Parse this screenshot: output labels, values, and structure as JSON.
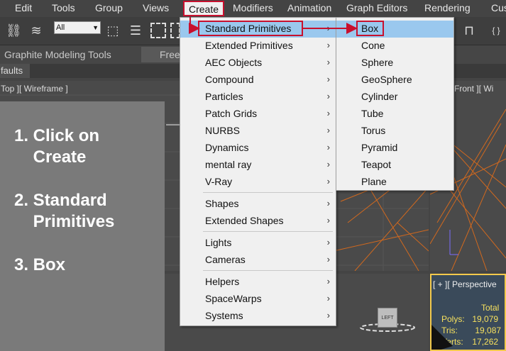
{
  "menubar": {
    "items": [
      "Edit",
      "Tools",
      "Group",
      "Views",
      "Create",
      "Modifiers",
      "Animation",
      "Graph Editors",
      "Rendering",
      "Cus"
    ]
  },
  "toolbar": {
    "selection_set": "All"
  },
  "ribbon": {
    "tab1": "Graphite Modeling Tools",
    "tab2": "Free",
    "subtab": "faults"
  },
  "viewports": {
    "top": "Top ][ Wireframe ]",
    "front": "Front ][ Wi",
    "persp": "[ + ][ Perspective",
    "gizmo_label": "LEFT",
    "stats": {
      "title": "Total",
      "polys_label": "Polys:",
      "polys": "19,079",
      "tris_label": "Tris:",
      "tris": "19,087",
      "verts_label": "Verts:",
      "verts": "17,262"
    }
  },
  "instructions": {
    "step1": "1. Click on\n    Create",
    "step2": "2. Standard\n    Primitives",
    "step3": "3. Box"
  },
  "create_menu": {
    "items": [
      "Standard Primitives",
      "Extended Primitives",
      "AEC Objects",
      "Compound",
      "Particles",
      "Patch Grids",
      "NURBS",
      "Dynamics",
      "mental ray",
      "V-Ray",
      "Shapes",
      "Extended Shapes",
      "Lights",
      "Cameras",
      "Helpers",
      "SpaceWarps",
      "Systems"
    ]
  },
  "primitives_menu": {
    "items": [
      "Box",
      "Cone",
      "Sphere",
      "GeoSphere",
      "Cylinder",
      "Tube",
      "Torus",
      "Pyramid",
      "Teapot",
      "Plane"
    ]
  },
  "colors": {
    "highlight_outline": "#c8102e",
    "menu_selected": "#9ac8ee",
    "wire_orange": "#d2691e"
  }
}
